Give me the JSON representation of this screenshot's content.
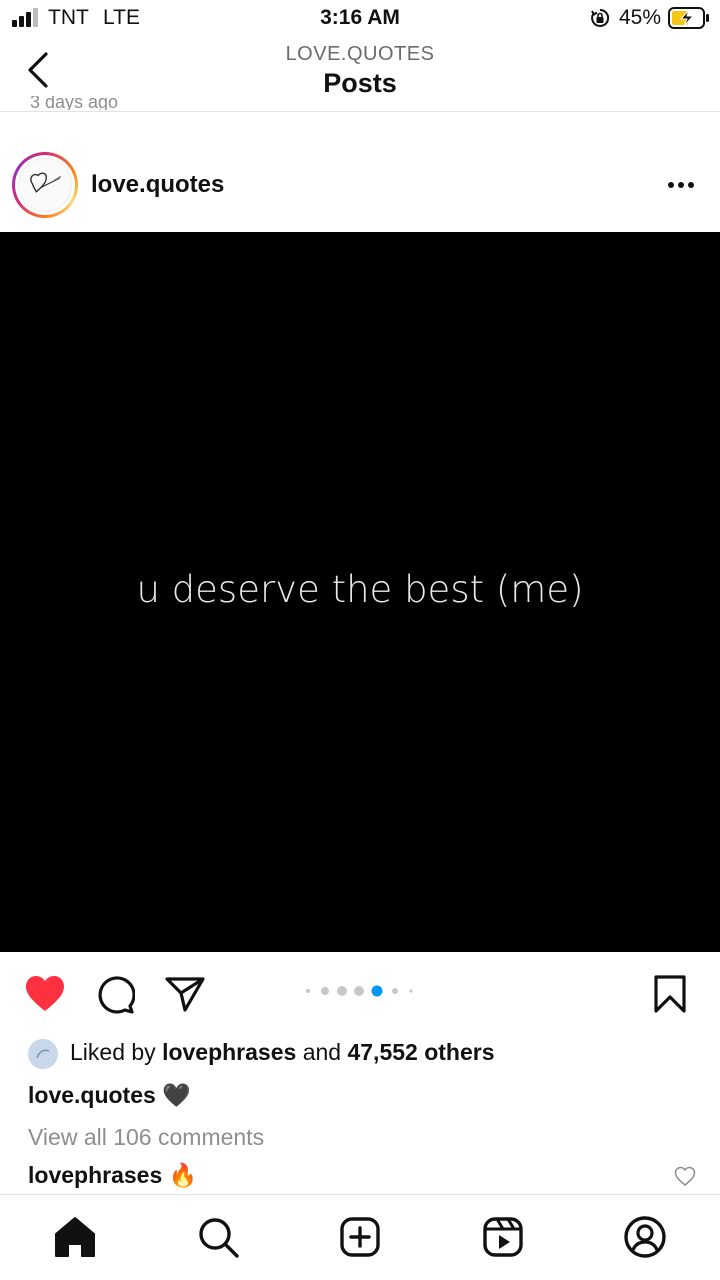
{
  "status_bar": {
    "carrier": "TNT",
    "network": "LTE",
    "time": "3:16 AM",
    "battery_percent": "45%"
  },
  "header": {
    "account": "LOVE.QUOTES",
    "title": "Posts",
    "back_icon": "chevron-left-icon"
  },
  "previous_post": {
    "caption_partial": "3 days ago"
  },
  "post": {
    "username": "love.quotes",
    "image_text": "u deserve the best (me)",
    "carousel": {
      "total": 6,
      "active_index": 3
    },
    "liked": true,
    "likes": {
      "prefix": "Liked by",
      "user": "lovephrases",
      "joiner": "and",
      "others": "47,552 others"
    },
    "caption": {
      "user": "love.quotes",
      "text": "🖤"
    },
    "view_comments": "View all 106 comments",
    "top_comment": {
      "user": "lovephrases",
      "text": "🔥"
    }
  },
  "tab_bar": {
    "items": [
      "home-icon",
      "search-icon",
      "create-icon",
      "reels-icon",
      "profile-icon"
    ]
  },
  "colors": {
    "like_red": "#ff3040",
    "carousel_active": "#0095f6",
    "muted_text": "#8e8e8e"
  }
}
